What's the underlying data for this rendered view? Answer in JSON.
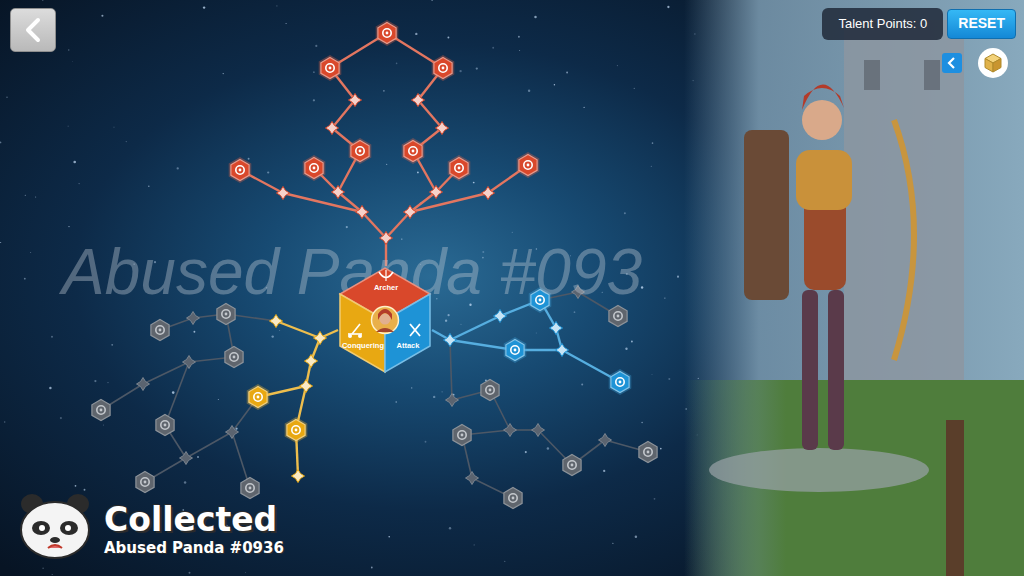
{
  "header": {
    "talent_points": "Talent Points: 0",
    "reset": "RESET"
  },
  "watermark": "Abused Panda #093",
  "trees": [
    {
      "label": "Archer",
      "color": "#d9482b",
      "nodes": [
        {
          "kind": "major",
          "active": true
        },
        {
          "kind": "major",
          "active": true
        },
        {
          "kind": "major",
          "active": true
        },
        {
          "kind": "minor",
          "active": true
        },
        {
          "kind": "minor",
          "active": true
        },
        {
          "kind": "minor",
          "active": true
        },
        {
          "kind": "minor",
          "active": true
        },
        {
          "kind": "major",
          "active": true
        },
        {
          "kind": "major",
          "active": true
        },
        {
          "kind": "major",
          "active": true
        },
        {
          "kind": "major",
          "active": true
        },
        {
          "kind": "major",
          "active": true
        },
        {
          "kind": "major",
          "active": true
        },
        {
          "kind": "minor",
          "active": true
        },
        {
          "kind": "minor",
          "active": true
        },
        {
          "kind": "minor",
          "active": true
        },
        {
          "kind": "minor",
          "active": true
        },
        {
          "kind": "minor",
          "active": true
        },
        {
          "kind": "minor",
          "active": true
        },
        {
          "kind": "minor",
          "active": true
        }
      ]
    },
    {
      "label": "Conquering",
      "color": "#e8a812",
      "nodes": [
        {
          "kind": "minor",
          "active": true
        },
        {
          "kind": "minor",
          "active": true
        },
        {
          "kind": "minor",
          "active": true
        },
        {
          "kind": "major",
          "active": true
        },
        {
          "kind": "minor",
          "active": true
        },
        {
          "kind": "minor",
          "active": true
        },
        {
          "kind": "major",
          "active": true
        },
        {
          "kind": "major",
          "active": false
        },
        {
          "kind": "major",
          "active": false
        },
        {
          "kind": "minor",
          "active": false
        },
        {
          "kind": "major",
          "active": false
        },
        {
          "kind": "minor",
          "active": false
        },
        {
          "kind": "minor",
          "active": false
        },
        {
          "kind": "major",
          "active": false
        },
        {
          "kind": "major",
          "active": false
        },
        {
          "kind": "minor",
          "active": false
        },
        {
          "kind": "minor",
          "active": false
        },
        {
          "kind": "major",
          "active": false
        },
        {
          "kind": "major",
          "active": false
        }
      ]
    },
    {
      "label": "Attack",
      "color": "#1e93d6",
      "nodes": [
        {
          "kind": "minor",
          "active": true
        },
        {
          "kind": "minor",
          "active": true
        },
        {
          "kind": "major",
          "active": true
        },
        {
          "kind": "minor",
          "active": true
        },
        {
          "kind": "major",
          "active": true
        },
        {
          "kind": "minor",
          "active": true
        },
        {
          "kind": "major",
          "active": true
        },
        {
          "kind": "minor",
          "active": false
        },
        {
          "kind": "major",
          "active": false
        },
        {
          "kind": "major",
          "active": false
        },
        {
          "kind": "minor",
          "active": false
        },
        {
          "kind": "minor",
          "active": false
        },
        {
          "kind": "major",
          "active": false
        },
        {
          "kind": "minor",
          "active": false
        },
        {
          "kind": "major",
          "active": false
        },
        {
          "kind": "major",
          "active": false
        },
        {
          "kind": "minor",
          "active": false
        },
        {
          "kind": "major",
          "active": false
        },
        {
          "kind": "minor",
          "active": false
        }
      ]
    }
  ],
  "collected": {
    "title": "Collected",
    "subtitle": "Abused Panda #0936"
  }
}
